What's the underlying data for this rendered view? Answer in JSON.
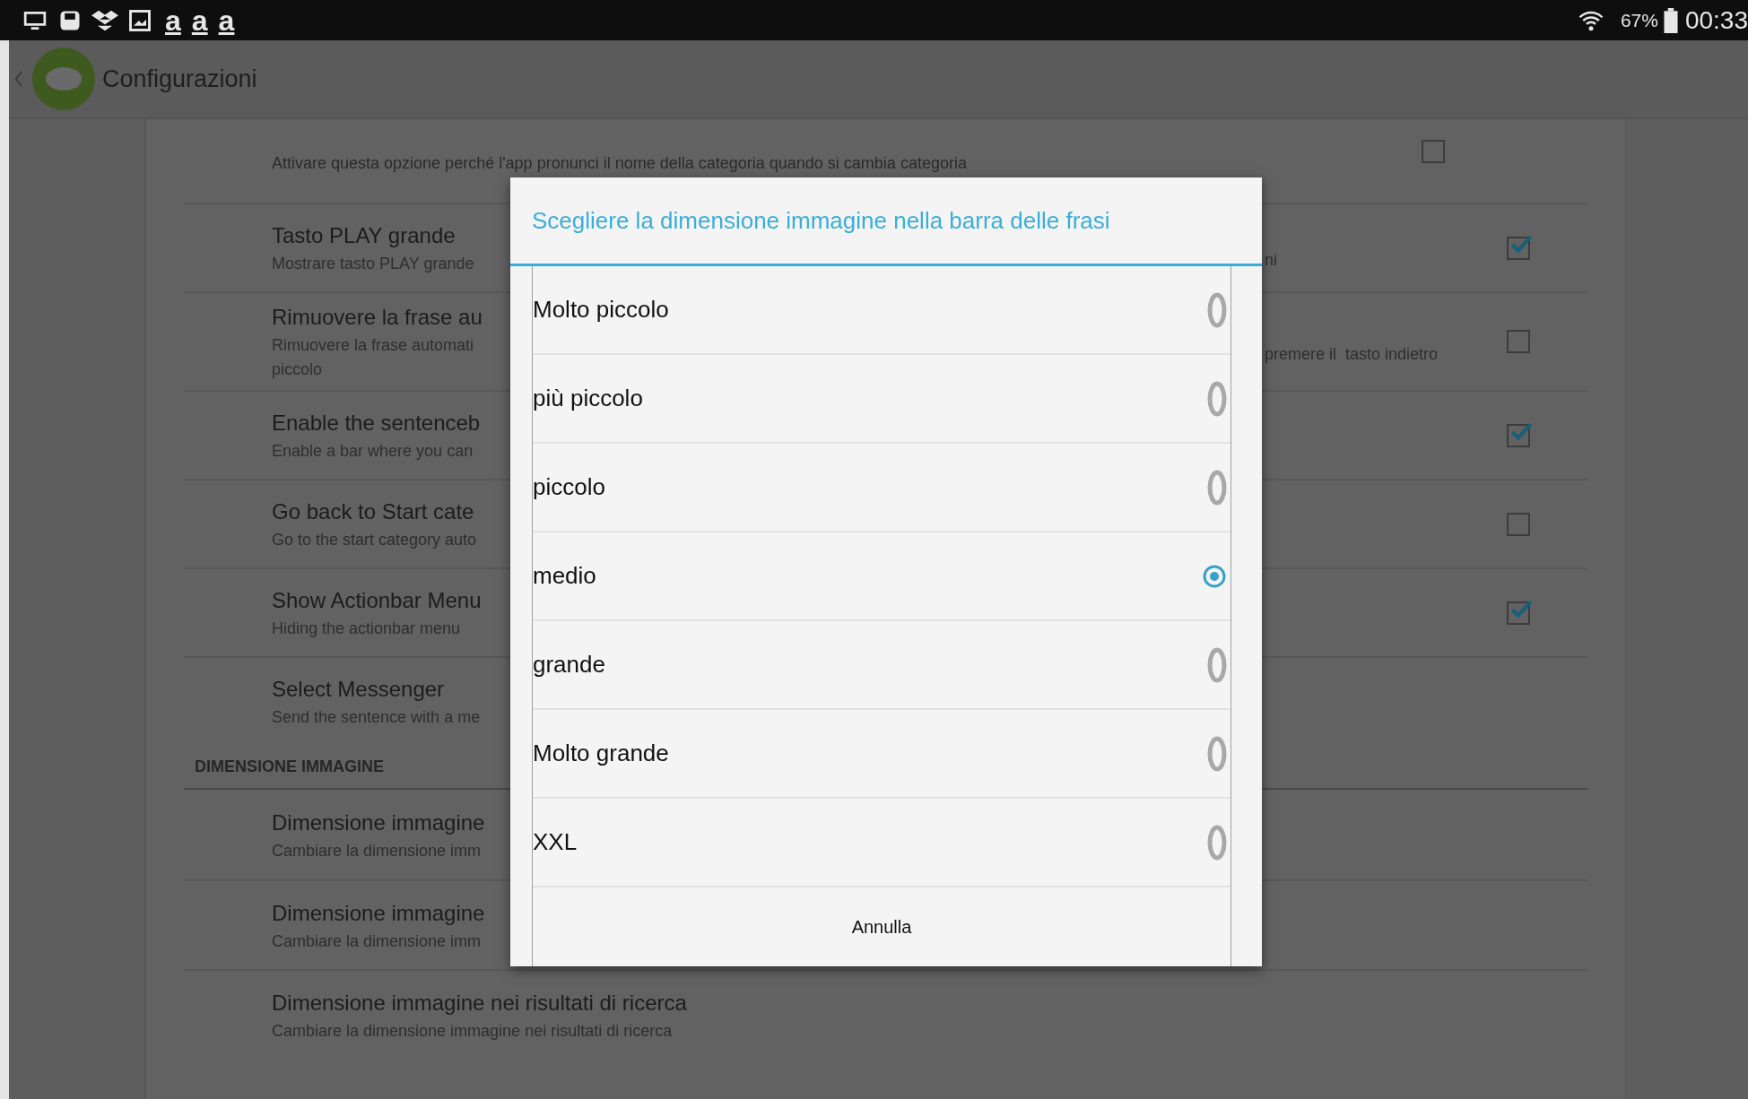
{
  "status_bar": {
    "letter_icons": [
      "a",
      "a",
      "a"
    ],
    "battery": "67%",
    "time": "00:33"
  },
  "action_bar": {
    "title": "Configurazioni"
  },
  "settings": {
    "top_note": {
      "text": "Attivare questa opzione perché l'app pronunci il nome della categoria quando si cambia categoria",
      "checked": false
    },
    "rows": [
      {
        "kind": "checkbox",
        "title": "Tasto PLAY grande",
        "desc": "Mostrare tasto PLAY grande",
        "desc_tail": "ni",
        "checked": true
      },
      {
        "kind": "checkbox",
        "title": "Rimuovere la frase au",
        "desc": "Rimuovere la frase automati",
        "desc_line2": "piccolo",
        "desc_tail": "premere il  tasto indietro",
        "checked": false
      },
      {
        "kind": "checkbox",
        "title": "Enable the sentenceb",
        "desc": "Enable a bar where you can",
        "checked": true
      },
      {
        "kind": "checkbox",
        "title": "Go back to Start cate",
        "desc": "Go to the start category auto",
        "checked": false
      },
      {
        "kind": "checkbox",
        "title": "Show Actionbar Menu",
        "desc": "Hiding the actionbar menu",
        "checked": true
      },
      {
        "kind": "plain",
        "title": "Select Messenger",
        "desc": "Send the sentence with a me"
      }
    ],
    "section": "DIMENSIONE IMMAGINE",
    "image_rows": [
      {
        "title": "Dimensione immagine",
        "desc": "Cambiare la dimensione imm"
      },
      {
        "title": "Dimensione immagine",
        "desc": "Cambiare la dimensione imm"
      },
      {
        "title": "Dimensione immagine nei risultati di ricerca",
        "desc": "Cambiare la dimensione immagine nei risultati di ricerca"
      }
    ]
  },
  "dialog": {
    "title": "Scegliere la dimensione immagine nella barra delle frasi",
    "options": [
      {
        "label": "Molto piccolo",
        "selected": false
      },
      {
        "label": "più piccolo",
        "selected": false
      },
      {
        "label": "piccolo",
        "selected": false
      },
      {
        "label": "medio",
        "selected": true
      },
      {
        "label": "grande",
        "selected": false
      },
      {
        "label": "Molto grande",
        "selected": false
      },
      {
        "label": "XXL",
        "selected": false
      }
    ],
    "cancel": "Annulla"
  }
}
